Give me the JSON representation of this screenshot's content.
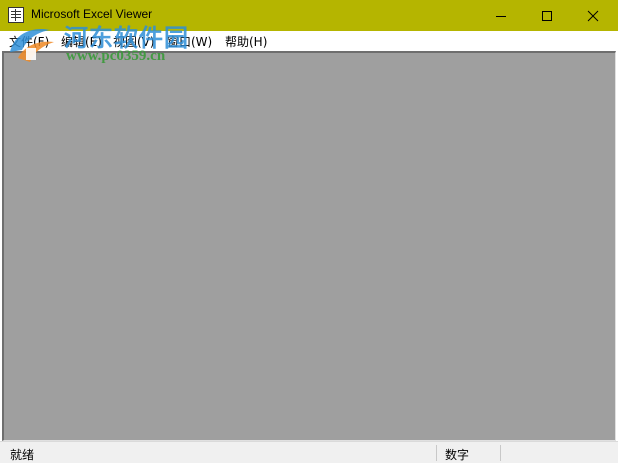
{
  "window": {
    "title": "Microsoft Excel Viewer",
    "titlebar_color": "#b5b500"
  },
  "controls": {
    "minimize": "minimize-icon",
    "maximize": "maximize-icon",
    "close": "close-icon"
  },
  "menu": {
    "items": [
      {
        "label": "文件(F)"
      },
      {
        "label": "编辑(E)"
      },
      {
        "label": "视图(V)"
      },
      {
        "label": "窗口(W)"
      },
      {
        "label": "帮助(H)"
      }
    ]
  },
  "workspace": {
    "background": "#9f9f9f"
  },
  "status": {
    "left": "就绪",
    "right": "数字"
  },
  "watermark": {
    "title": "河东软件园",
    "url": "www.pc0359.cn"
  }
}
